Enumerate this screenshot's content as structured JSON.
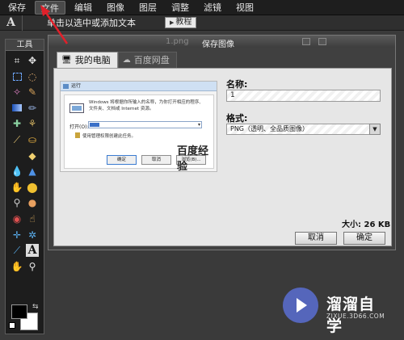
{
  "menubar": {
    "items": [
      "保存",
      "文件",
      "编辑",
      "图像",
      "图层",
      "调整",
      "滤镜",
      "视图"
    ]
  },
  "optbar": {
    "tool_letter": "A",
    "hint": "单击以选中或添加文本",
    "tutorial": "教程"
  },
  "toolpanel": {
    "title": "工具",
    "tools": [
      "crop-icon",
      "move-icon",
      "marquee-icon",
      "lasso-icon",
      "wand-icon",
      "brush-icon",
      "gradient-icon",
      "pencil-icon",
      "heal-icon",
      "clone-icon",
      "eyedropper-icon",
      "stamp-icon",
      "blank",
      "eraser-icon",
      "drop-icon",
      "sharpen-icon",
      "burn-icon",
      "dodge-icon",
      "zoom-lens-icon",
      "sponge-icon",
      "redeye-icon",
      "smudge-icon",
      "move-arrows-icon",
      "transform-icon",
      "pen-icon",
      "text-tool",
      "hand-icon",
      "zoom-icon"
    ],
    "text_tool_label": "A",
    "fg_color": "#000000",
    "bg_color": "#ffffff"
  },
  "dialog": {
    "file": "1.png",
    "title": "保存图像",
    "tabs": [
      {
        "label": "我的电脑",
        "icon": "computer-icon"
      },
      {
        "label": "百度网盘",
        "icon": "cloud-icon"
      }
    ],
    "name_label": "名称:",
    "name_value": "1",
    "format_label": "格式:",
    "format_value": "PNG（透明、全品质图像）",
    "size_text": "大小: 26 KB",
    "cancel": "取消",
    "ok": "确定"
  },
  "preview": {
    "title": "运行",
    "desc": "Windows 将根据你所输入的名称，为你打开相应的程序、文件夹、文档或 Internet 资源。",
    "open_label": "打开(O):",
    "open_value": "cmd",
    "admin_note": "使用管理权限创建此任务。",
    "buttons": [
      "确定",
      "取消",
      "浏览(B)..."
    ],
    "watermark": "百度经验"
  },
  "logo": {
    "name": "溜溜自学",
    "url": "ZIXUE.3D66.COM"
  },
  "colors": {
    "menubar_bg": "#1e1e1e",
    "annotation_arrow": "#e0202a"
  }
}
